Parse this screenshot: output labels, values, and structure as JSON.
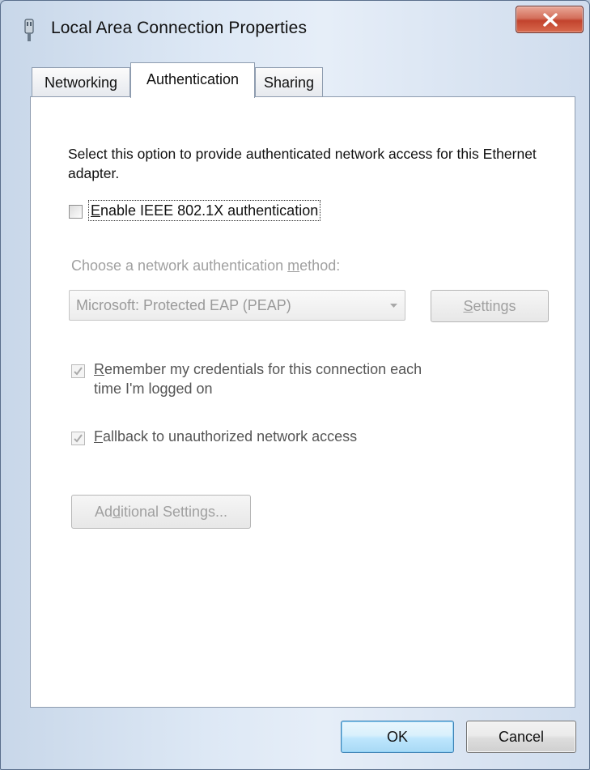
{
  "window": {
    "title": "Local Area Connection Properties",
    "close_glyph": "x",
    "close_color": "#c7432d",
    "icon": "network-adapter-icon"
  },
  "tabs": [
    {
      "label": "Networking",
      "active": false
    },
    {
      "label": "Authentication",
      "active": true
    },
    {
      "label": "Sharing",
      "active": false
    }
  ],
  "authentication": {
    "description": "Select this option to provide authenticated network access for this Ethernet adapter.",
    "enable_ieee": {
      "prefix": "E",
      "rest": "nable IEEE 802.1X authentication",
      "checked": false
    },
    "method_label": {
      "before": "Choose a network authentication ",
      "mnemonic": "m",
      "after": "ethod:"
    },
    "method_value": "Microsoft: Protected EAP (PEAP)",
    "settings_button": {
      "mnemonic": "S",
      "rest": "ettings"
    },
    "remember_credentials": {
      "mnemonic": "R",
      "line1_rest": "emember my credentials for this connection each",
      "line2": "time I'm logged on",
      "checked": true
    },
    "fallback": {
      "mnemonic": "F",
      "rest": "allback to unauthorized network access",
      "checked": true
    },
    "additional_settings_button": {
      "before": "Ad",
      "mnemonic": "d",
      "after": "itional Settings..."
    }
  },
  "footer": {
    "ok_label": "OK",
    "cancel_label": "Cancel"
  },
  "colors": {
    "accent": "#3c7fb1",
    "disabled_text": "#a0a0a0"
  }
}
